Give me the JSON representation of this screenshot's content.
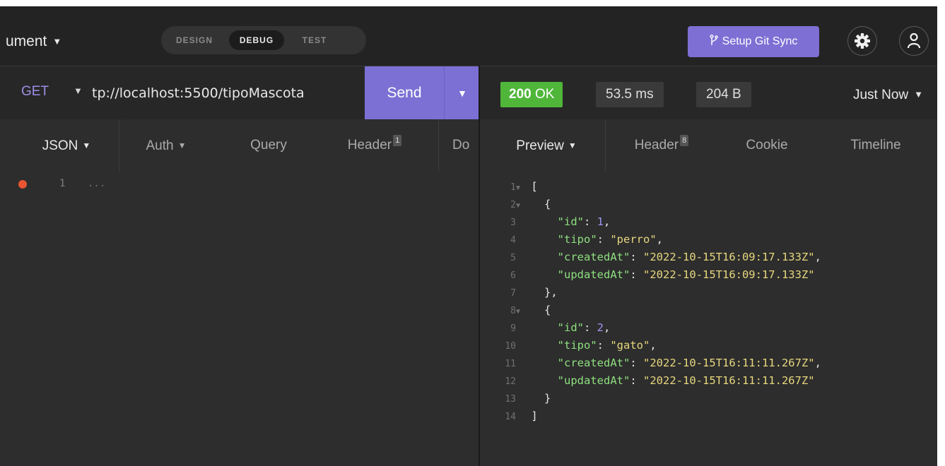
{
  "top_bar": {
    "document_name": "ument",
    "mode_tabs": [
      "DESIGN",
      "DEBUG",
      "TEST"
    ],
    "active_mode": "DEBUG",
    "git_button_label": "Setup Git Sync",
    "icons": {
      "git": "git-icon",
      "settings": "gear-icon",
      "account": "account-icon"
    }
  },
  "request_bar": {
    "method": "GET",
    "url": "tp://localhost:5500/tipoMascota",
    "send_label": "Send"
  },
  "response_bar": {
    "status_code": "200",
    "status_text": "OK",
    "time": "53.5 ms",
    "size": "204 B",
    "timestamp_label": "Just Now"
  },
  "request_tabs": [
    {
      "label": "JSON",
      "caret": true
    },
    {
      "label": "Auth",
      "caret": true
    },
    {
      "label": "Query"
    },
    {
      "label": "Header",
      "badge": "1"
    },
    {
      "label": "Do"
    }
  ],
  "response_tabs": [
    {
      "label": "Preview",
      "caret": true
    },
    {
      "label": "Header",
      "badge": "8"
    },
    {
      "label": "Cookie"
    },
    {
      "label": "Timeline"
    }
  ],
  "request_editor": {
    "line_number": "1",
    "ellipsis": "..."
  },
  "response_preview": {
    "lines": [
      {
        "num": "1",
        "fold": true,
        "text": "[",
        "indent": 0
      },
      {
        "num": "2",
        "fold": true,
        "text": "{",
        "indent": 2
      },
      {
        "num": "3",
        "key": "\"id\"",
        "value": "1",
        "value_type": "number",
        "trail": ",",
        "indent": 4
      },
      {
        "num": "4",
        "key": "\"tipo\"",
        "value": "\"perro\"",
        "value_type": "string",
        "trail": ",",
        "indent": 4
      },
      {
        "num": "5",
        "key": "\"createdAt\"",
        "value": "\"2022-10-15T16:09:17.133Z\"",
        "value_type": "string",
        "trail": ",",
        "indent": 4
      },
      {
        "num": "6",
        "key": "\"updatedAt\"",
        "value": "\"2022-10-15T16:09:17.133Z\"",
        "value_type": "string",
        "trail": "",
        "indent": 4
      },
      {
        "num": "7",
        "text": "},",
        "indent": 2
      },
      {
        "num": "8",
        "fold": true,
        "text": "{",
        "indent": 2
      },
      {
        "num": "9",
        "key": "\"id\"",
        "value": "2",
        "value_type": "number",
        "trail": ",",
        "indent": 4
      },
      {
        "num": "10",
        "key": "\"tipo\"",
        "value": "\"gato\"",
        "value_type": "string",
        "trail": ",",
        "indent": 4
      },
      {
        "num": "11",
        "key": "\"createdAt\"",
        "value": "\"2022-10-15T16:11:11.267Z\"",
        "value_type": "string",
        "trail": ",",
        "indent": 4
      },
      {
        "num": "12",
        "key": "\"updatedAt\"",
        "value": "\"2022-10-15T16:11:11.267Z\"",
        "value_type": "string",
        "trail": "",
        "indent": 4
      },
      {
        "num": "13",
        "text": "}",
        "indent": 2
      },
      {
        "num": "14",
        "text": "]",
        "indent": 0
      }
    ]
  },
  "colors": {
    "accent": "#7c70d4",
    "status_ok": "#4fb63a",
    "json_key": "#8ee07f",
    "json_string": "#e7d77e",
    "json_number": "#9d95f0",
    "breakpoint_dot": "#e95532"
  }
}
